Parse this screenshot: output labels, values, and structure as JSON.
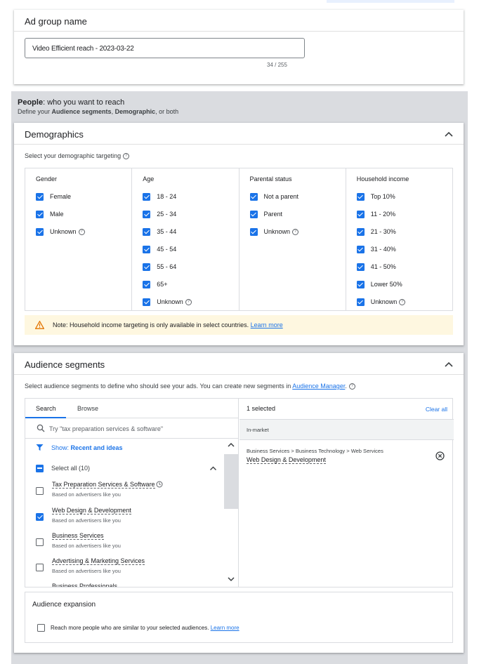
{
  "ad_group": {
    "title": "Ad group name",
    "name_value": "Video Efficient reach - 2023-03-22",
    "counter": "34 / 255"
  },
  "people": {
    "title_bold": "People",
    "title_rest": ": who you want to reach",
    "sub_prefix": "Define your ",
    "sub_bold1": "Audience segments",
    "sub_sep": ", ",
    "sub_bold2": "Demographic",
    "sub_suffix": ", or both"
  },
  "demographics": {
    "title": "Demographics",
    "select_label": "Select your demographic targeting",
    "columns": [
      {
        "head": "Gender",
        "items": [
          {
            "label": "Female",
            "checked": true
          },
          {
            "label": "Male",
            "checked": true
          },
          {
            "label": "Unknown",
            "checked": true,
            "help": true
          }
        ]
      },
      {
        "head": "Age",
        "items": [
          {
            "label": "18 - 24",
            "checked": true
          },
          {
            "label": "25 - 34",
            "checked": true
          },
          {
            "label": "35 - 44",
            "checked": true
          },
          {
            "label": "45 - 54",
            "checked": true
          },
          {
            "label": "55 - 64",
            "checked": true
          },
          {
            "label": "65+",
            "checked": true
          },
          {
            "label": "Unknown",
            "checked": true,
            "help": true
          }
        ]
      },
      {
        "head": "Parental status",
        "items": [
          {
            "label": "Not a parent",
            "checked": true
          },
          {
            "label": "Parent",
            "checked": true
          },
          {
            "label": "Unknown",
            "checked": true,
            "help": true
          }
        ]
      },
      {
        "head": "Household income",
        "items": [
          {
            "label": "Top 10%",
            "checked": true
          },
          {
            "label": "11 - 20%",
            "checked": true
          },
          {
            "label": "21 - 30%",
            "checked": true
          },
          {
            "label": "31 - 40%",
            "checked": true
          },
          {
            "label": "41 - 50%",
            "checked": true
          },
          {
            "label": "Lower 50%",
            "checked": true
          },
          {
            "label": "Unknown",
            "checked": true,
            "help": true
          }
        ]
      }
    ],
    "note_text": "Note: Household income targeting is only available in select countries.",
    "note_link": "Learn more"
  },
  "audience": {
    "title": "Audience segments",
    "desc": "Select audience segments to define who should see your ads. You can create new segments in",
    "desc_link": "Audience Manager",
    "desc_end": ".",
    "tab_search": "Search",
    "tab_browse": "Browse",
    "search_placeholder": "Try \"tax preparation services & software\"",
    "show_label": "Show: ",
    "show_value": "Recent and ideas",
    "select_all": "Select all (10)",
    "items": [
      {
        "title": "Tax Preparation Services & Software",
        "sub": "Based on advertisers like you",
        "checked": false,
        "clock": true
      },
      {
        "title": "Web Design & Development",
        "sub": "Based on advertisers like you",
        "checked": true
      },
      {
        "title": "Business Services",
        "sub": "Based on advertisers like you",
        "checked": false
      },
      {
        "title": "Advertising & Marketing Services",
        "sub": "Based on advertisers like you",
        "checked": false
      },
      {
        "title": "Business Professionals",
        "sub": "",
        "checked": false
      }
    ],
    "selected_count": "1 selected",
    "clear_all": "Clear all",
    "category": "In-market",
    "selected_path": "Business Services > Business Technology > Web Services",
    "selected_name": "Web Design & Development"
  },
  "expansion": {
    "title": "Audience expansion",
    "text": "Reach more people who are similar to your selected audiences.",
    "link": "Learn more"
  },
  "colors": {
    "accent": "#1a73e8",
    "warning": "#e37400",
    "note_bg": "#fef7e0"
  }
}
